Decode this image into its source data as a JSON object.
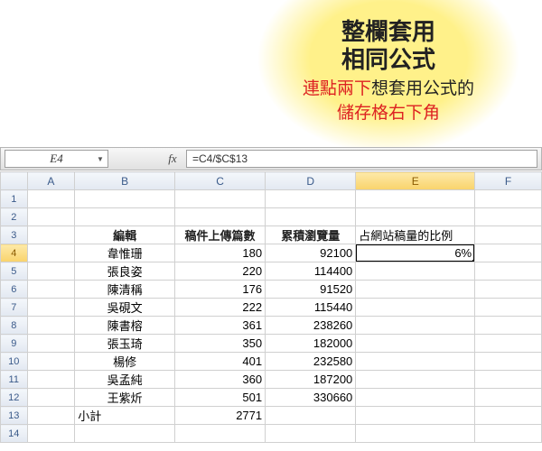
{
  "annotation": {
    "title_line1": "整欄套用",
    "title_line2": "相同公式",
    "sub_pre": "連點兩下",
    "sub_mid": "想套用公式的",
    "sub_post": "儲存格右下角"
  },
  "formula_bar": {
    "cell_ref": "E4",
    "fx_label": "fx",
    "formula": "=C4/$C$13"
  },
  "columns": [
    "A",
    "B",
    "C",
    "D",
    "E",
    "F"
  ],
  "selected_col": "E",
  "selected_row": "4",
  "headers": {
    "b": "編輯",
    "c": "稿件上傳篇數",
    "d": "累積瀏覽量",
    "e": "占網站稿量的比例"
  },
  "rows": [
    {
      "n": "4",
      "b": "韋惟珊",
      "c": "180",
      "d": "92100",
      "e": "6%"
    },
    {
      "n": "5",
      "b": "張良姿",
      "c": "220",
      "d": "114400",
      "e": ""
    },
    {
      "n": "6",
      "b": "陳清稱",
      "c": "176",
      "d": "91520",
      "e": ""
    },
    {
      "n": "7",
      "b": "吳硯文",
      "c": "222",
      "d": "115440",
      "e": ""
    },
    {
      "n": "8",
      "b": "陳書榕",
      "c": "361",
      "d": "238260",
      "e": ""
    },
    {
      "n": "9",
      "b": "張玉琦",
      "c": "350",
      "d": "182000",
      "e": ""
    },
    {
      "n": "10",
      "b": "楊修",
      "c": "401",
      "d": "232580",
      "e": ""
    },
    {
      "n": "11",
      "b": "吳孟純",
      "c": "360",
      "d": "187200",
      "e": ""
    },
    {
      "n": "12",
      "b": "王紫炘",
      "c": "501",
      "d": "330660",
      "e": ""
    }
  ],
  "subtotal": {
    "n": "13",
    "label": "小計",
    "value": "2771"
  },
  "empty_rows": [
    "1",
    "2",
    "14"
  ]
}
